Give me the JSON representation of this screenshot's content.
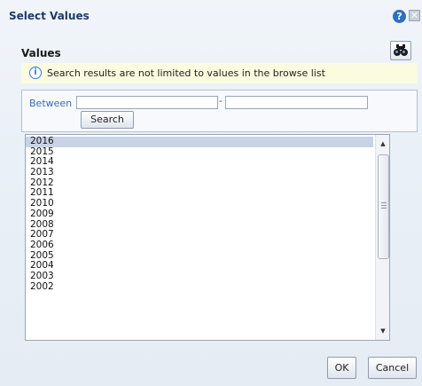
{
  "dialog": {
    "title": "Select Values",
    "help_icon": "help-icon",
    "close_icon": "close-icon",
    "help_glyph": "?",
    "close_glyph": "✕"
  },
  "values_section": {
    "heading": "Values",
    "find_icon": "binoculars-icon",
    "info_icon": "info-icon",
    "info_glyph": "i",
    "info_text": "Search results are not limited to values in the browse list"
  },
  "between": {
    "label": "Between",
    "separator": "-",
    "from_value": "",
    "to_value": "",
    "search_button": "Search"
  },
  "values_list": {
    "selected": "2016",
    "items": [
      "2016",
      "2015",
      "2014",
      "2013",
      "2012",
      "2011",
      "2010",
      "2009",
      "2008",
      "2007",
      "2006",
      "2005",
      "2004",
      "2003",
      "2002"
    ]
  },
  "footer": {
    "ok": "OK",
    "cancel": "Cancel"
  },
  "colors": {
    "title": "#1d3a6e",
    "info_background": "#fbfbe0",
    "selection": "#c8d3e6",
    "between_label": "#3b6cb3"
  }
}
